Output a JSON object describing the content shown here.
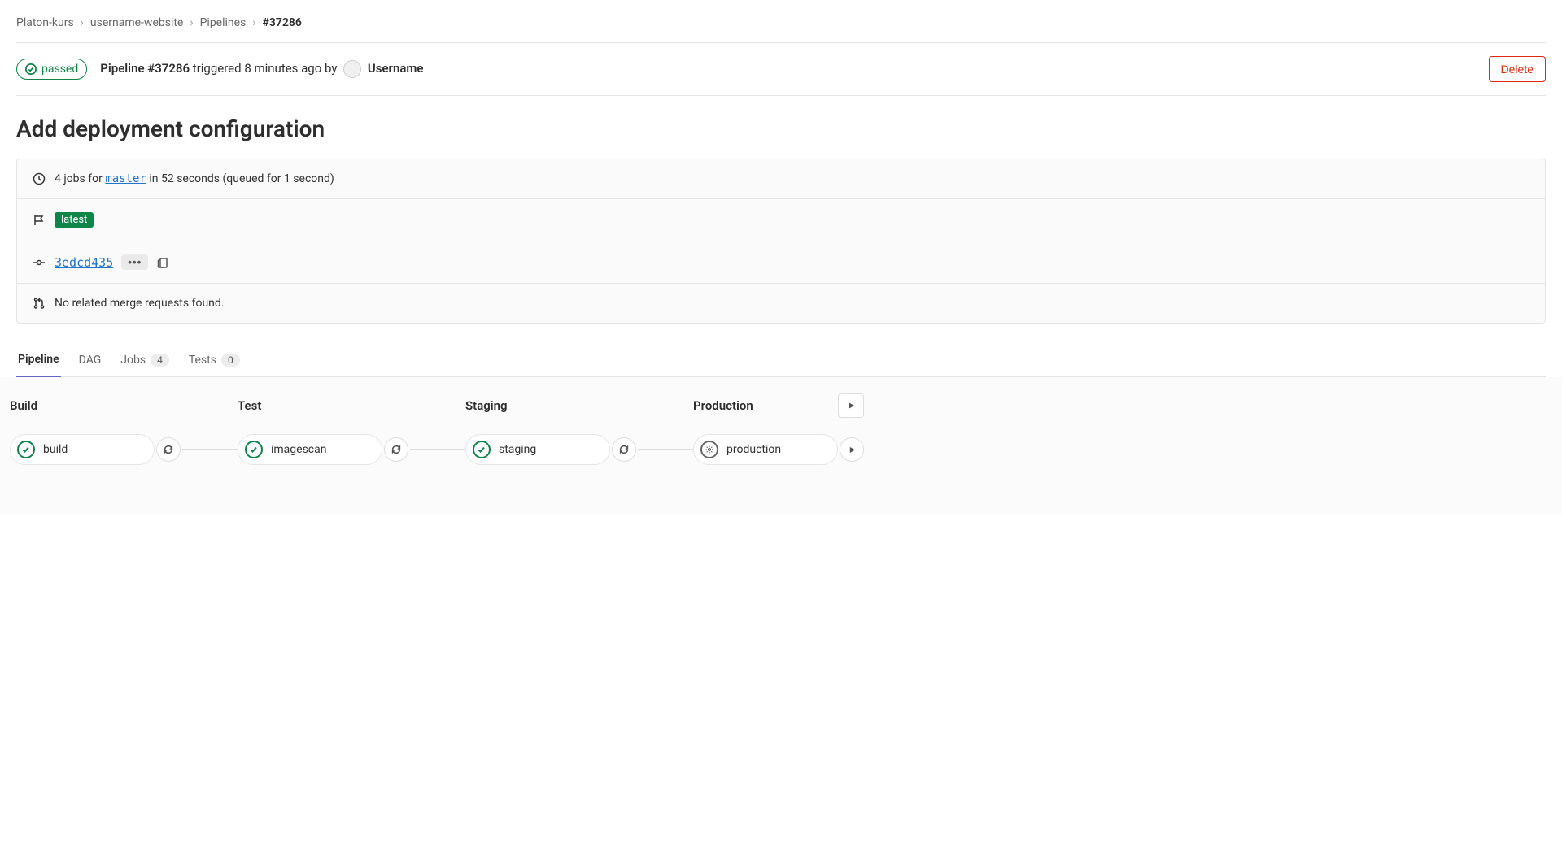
{
  "breadcrumb": {
    "group": "Platon-kurs",
    "project": "username-website",
    "section": "Pipelines",
    "current": "#37286"
  },
  "header": {
    "status": "passed",
    "pipeline_label": "Pipeline #37286",
    "triggered_text": "triggered 8 minutes ago by",
    "username": "Username",
    "delete_label": "Delete"
  },
  "title": "Add deployment configuration",
  "details": {
    "jobs_prefix": "4 jobs for",
    "branch": "master",
    "jobs_suffix": "in 52 seconds (queued for 1 second)",
    "latest_tag": "latest",
    "commit_sha": "3edcd435",
    "merge_requests": "No related merge requests found."
  },
  "tabs": {
    "pipeline": "Pipeline",
    "dag": "DAG",
    "jobs": "Jobs",
    "jobs_count": "4",
    "tests": "Tests",
    "tests_count": "0"
  },
  "stages": [
    {
      "title": "Build",
      "job": "build",
      "status": "passed",
      "action": "retry"
    },
    {
      "title": "Test",
      "job": "imagescan",
      "status": "passed",
      "action": "retry"
    },
    {
      "title": "Staging",
      "job": "staging",
      "status": "passed",
      "action": "retry"
    },
    {
      "title": "Production",
      "job": "production",
      "status": "manual",
      "action": "play",
      "stage_play": true
    }
  ]
}
